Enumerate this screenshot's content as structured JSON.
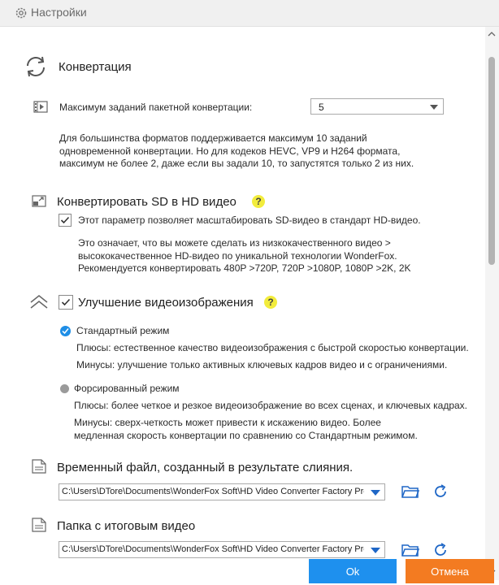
{
  "window": {
    "title": "Настройки"
  },
  "conversion": {
    "title": "Конвертация",
    "max_jobs_label": "Максимум заданий пакетной конвертации:",
    "max_jobs_value": "5",
    "note_lines": [
      "Для большинства форматов поддерживается максимум 10 заданий",
      "одновременной конвертации. Но для кодеков HEVC, VP9 и H264 формата,",
      "максимум не более 2, даже если вы задали 10, то запустятся только 2 из них."
    ]
  },
  "sd_to_hd": {
    "title": "Конвертировать SD в HD видео",
    "help": "?",
    "checkbox_label": "Этот параметр позволяет масштабировать SD-видео в стандарт HD-видео.",
    "checked": true,
    "note_lines": [
      "Это означает, что вы можете сделать из низкокачественного видео >",
      "высококачественное HD-видео по уникальной технологии WonderFox.",
      "Рекомендуется конвертировать 480P >720P, 720P >1080P, 1080P >2K, 2K"
    ]
  },
  "enhance": {
    "title": "Улучшение видеоизображения",
    "help": "?",
    "checked": true,
    "standard_mode": {
      "label": "Стандартный режим",
      "selected": true,
      "pros": "Плюсы: естественное качество видеоизображения с быстрой скоростью конвертации.",
      "cons": "Минусы: улучшение только активных ключевых кадров видео и с ограничениями."
    },
    "forced_mode": {
      "label": "Форсированный режим",
      "selected": false,
      "pros": "Плюсы: более четкое и резкое видеоизображение во всех сценах, и ключевых кадрах.",
      "cons_lines": [
        "Минусы: сверх-четкость может привести к искажению видео. Более",
        "медленная скорость конвертации по сравнению со Стандартным режимом."
      ]
    }
  },
  "temp_file": {
    "title": "Временный файл, созданный в результате слияния.",
    "path": "C:\\Users\\DTore\\Documents\\WonderFox Soft\\HD Video Converter Factory Pro"
  },
  "output_folder": {
    "title": "Папка с итоговым видео",
    "path": "C:\\Users\\DTore\\Documents\\WonderFox Soft\\HD Video Converter Factory Pro"
  },
  "buttons": {
    "ok": "Ok",
    "cancel": "Отмена"
  },
  "colors": {
    "ok_bg": "#1e90ee",
    "cancel_bg": "#f37b21",
    "accent": "#1e66c6",
    "help_bg": "#f2ec3c"
  },
  "icons": [
    "gear-icon",
    "refresh-cycle-icon",
    "film-icon",
    "sd-hd-icon",
    "checkmark-icon",
    "double-chevron-up-icon",
    "file-icon",
    "folder-icon",
    "refresh-icon",
    "scroll-up-icon",
    "scroll-down-icon"
  ]
}
